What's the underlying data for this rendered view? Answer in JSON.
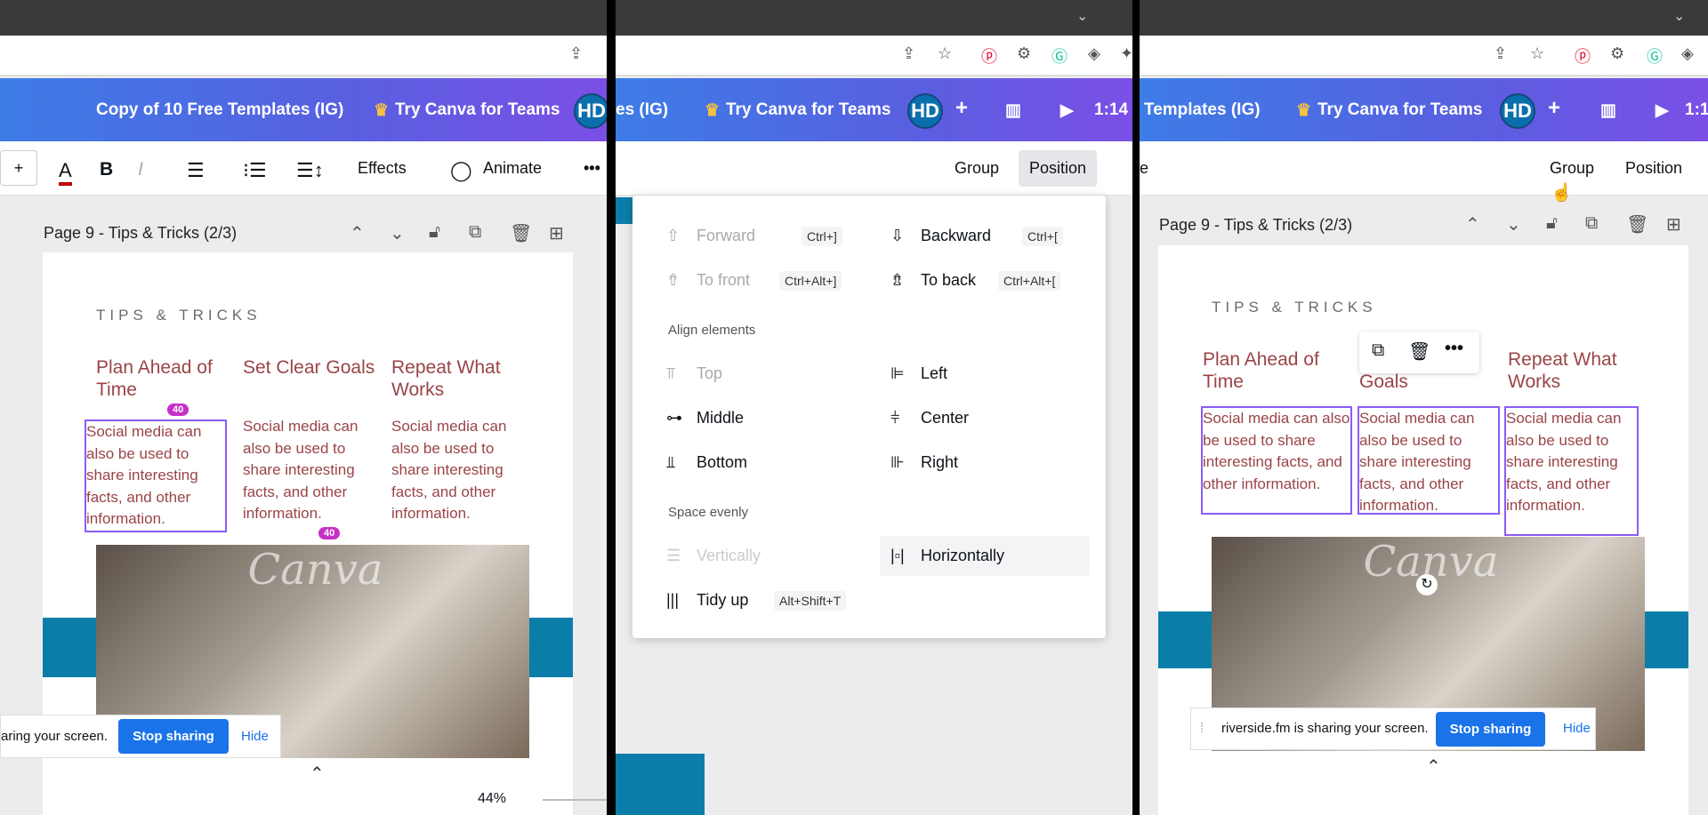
{
  "header": {
    "doc_title": "Copy of 10 Free Templates (IG)",
    "doc_title_p2": "es (IG)",
    "doc_title_p3": "Templates (IG)",
    "teams": "Try Canva for Teams",
    "avatar": "HD",
    "timer": "1:14",
    "timer_p3": "1:1"
  },
  "toolbar": {
    "effects": "Effects",
    "animate": "Animate",
    "group": "Group",
    "position": "Position",
    "partial": "e"
  },
  "page": {
    "title": "Page 9 - Tips & Tricks (2/3)",
    "tips": "TIPS & TRICKS",
    "columns": [
      {
        "heading": "Plan Ahead of Time",
        "body": "Social media can also be used to share interesting facts, and other information."
      },
      {
        "heading": "Set Clear Goals",
        "body": "Social media can also be used to share interesting facts, and other information."
      },
      {
        "heading": "Repeat What Works",
        "body": "Social media can also be used to share interesting facts, and other information."
      }
    ],
    "goals_partial": "Goals",
    "badge": "40",
    "watermark": "Canva"
  },
  "sharing": {
    "text_p1": "aring your screen.",
    "text": "riverside.fm is sharing your screen.",
    "stop": "Stop sharing",
    "hide": "Hide"
  },
  "zoom": "44%",
  "position_menu": {
    "forward": "Forward",
    "forward_key": "Ctrl+]",
    "backward": "Backward",
    "backward_key": "Ctrl+[",
    "to_front": "To front",
    "to_front_key": "Ctrl+Alt+]",
    "to_back": "To back",
    "to_back_key": "Ctrl+Alt+[",
    "align_heading": "Align elements",
    "top": "Top",
    "left": "Left",
    "middle": "Middle",
    "center": "Center",
    "bottom": "Bottom",
    "right": "Right",
    "space_heading": "Space evenly",
    "vertically": "Vertically",
    "horizontally": "Horizontally",
    "tidy": "Tidy up",
    "tidy_key": "Alt+Shift+T"
  },
  "colors": {
    "accent": "#8b5cf6",
    "heading": "#9a4447",
    "band": "#0a7ea8",
    "share_button": "#1a73e8"
  }
}
